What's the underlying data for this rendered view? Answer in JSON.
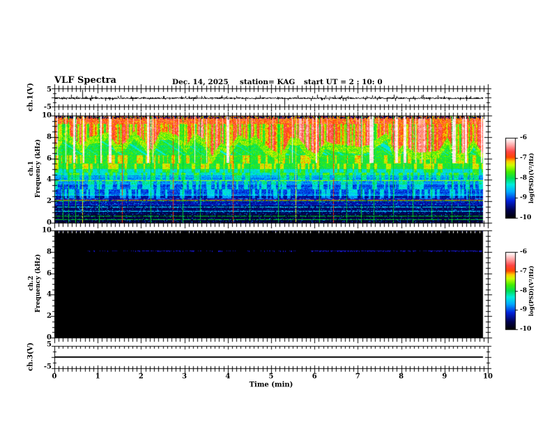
{
  "header": {
    "title": "VLF Spectra",
    "date": "Dec. 14, 2025",
    "station": "station= KAG",
    "start_ut": "start UT =  2 : 10: 0"
  },
  "axes": {
    "time_label": "Time (min)",
    "time_ticks": [
      0,
      1,
      2,
      3,
      4,
      5,
      6,
      7,
      8,
      9,
      10
    ],
    "time_minor_per_major": 10,
    "freq_ticks": [
      0,
      2,
      4,
      6,
      8,
      10
    ],
    "freq_minor_step_khz": 0.5,
    "volt_ticks": [
      5,
      -5
    ]
  },
  "panels": {
    "ch1_wave": {
      "ylabel": "ch.1(V)",
      "ymax_label": "5",
      "ymin_label": "-5"
    },
    "ch1_spec": {
      "label_line1": "ch.1",
      "label_line2": "Frequency (kHz)"
    },
    "ch2_spec": {
      "label_line1": "ch.2",
      "label_line2": "Frequency (kHz)"
    },
    "ch3_wave": {
      "ylabel": "ch.3(V)",
      "ymax_label": "5",
      "ymin_label": "-5"
    }
  },
  "colorbar": {
    "label": "log(PSD)(V²/Hz)",
    "ticks": [
      -6,
      -7,
      -8,
      -9,
      -10
    ],
    "gradient": [
      [
        0.0,
        "#000000"
      ],
      [
        0.1,
        "#00004d"
      ],
      [
        0.22,
        "#0022dd"
      ],
      [
        0.33,
        "#00aaff"
      ],
      [
        0.42,
        "#00eedd"
      ],
      [
        0.5,
        "#00dd55"
      ],
      [
        0.58,
        "#44ee00"
      ],
      [
        0.66,
        "#ccff00"
      ],
      [
        0.71,
        "#ffcc00"
      ],
      [
        0.76,
        "#ff4400"
      ],
      [
        0.83,
        "#ff4444"
      ],
      [
        0.9,
        "#ff9999"
      ],
      [
        0.96,
        "#ffdddd"
      ],
      [
        1.0,
        "#ffffff"
      ]
    ]
  },
  "chart_data": [
    {
      "id": "ch1_waveform",
      "type": "line",
      "channel": "ch.1(V)",
      "ylim": [
        -5,
        5
      ],
      "xlim_min": [
        0,
        10
      ],
      "baseline_v": 0,
      "noise_v": 0.45,
      "data_end_min": 9.85,
      "spikes": [
        {
          "t": 0.38,
          "v": 1.8
        },
        {
          "t": 0.52,
          "v": 1.2
        },
        {
          "t": 0.64,
          "v": 4.6
        },
        {
          "t": 0.72,
          "v": 1.0
        },
        {
          "t": 0.86,
          "v": 1.6
        },
        {
          "t": 0.95,
          "v": 1.2
        },
        {
          "t": 1.35,
          "v": -0.9
        },
        {
          "t": 1.77,
          "v": 1.1
        },
        {
          "t": 2.05,
          "v": 0.9
        },
        {
          "t": 2.5,
          "v": 1.0
        },
        {
          "t": 2.92,
          "v": 1.3
        },
        {
          "t": 3.45,
          "v": 1.0
        },
        {
          "t": 4.2,
          "v": 1.1
        },
        {
          "t": 4.75,
          "v": 1.5
        },
        {
          "t": 5.3,
          "v": -6.5
        },
        {
          "t": 5.95,
          "v": 1.0
        },
        {
          "t": 6.6,
          "v": 0.9
        },
        {
          "t": 7.4,
          "v": 1.0
        },
        {
          "t": 7.9,
          "v": 1.3
        },
        {
          "t": 8.5,
          "v": 1.0
        },
        {
          "t": 8.85,
          "v": 1.4
        },
        {
          "t": 9.35,
          "v": -1.2
        },
        {
          "t": 9.6,
          "v": 1.0
        }
      ]
    },
    {
      "id": "ch1_spectrogram",
      "type": "heatmap",
      "channel": "ch.1",
      "ylim_khz": [
        0,
        10
      ],
      "xlim_min": [
        0,
        10
      ],
      "data_end_min": 9.85,
      "psd_range": [
        -10,
        -6
      ],
      "bands": [
        {
          "f": [
            9.25,
            10.0
          ],
          "psd": -6.9,
          "jitter": 0.8
        },
        {
          "f": [
            6.3,
            9.25
          ],
          "psd": "curtain"
        },
        {
          "f": [
            5.0,
            6.3
          ],
          "psd": -7.85,
          "jitter": 0.5
        },
        {
          "f": [
            4.4,
            5.0
          ],
          "psd": -8.35,
          "jitter": 0.5
        },
        {
          "f": [
            3.6,
            4.4
          ],
          "psd": -8.7,
          "jitter": 0.5
        },
        {
          "f": [
            2.6,
            3.6
          ],
          "psd": -9.0,
          "jitter": 0.5
        },
        {
          "f": [
            1.6,
            2.6
          ],
          "psd": -9.3,
          "jitter": 0.4
        },
        {
          "f": [
            0.8,
            1.6
          ],
          "psd": -9.55,
          "jitter": 0.3
        },
        {
          "f": [
            0.0,
            0.8
          ],
          "psd": -9.7,
          "jitter": 0.25
        }
      ],
      "curtain": {
        "bottom_khz": [
          6.2,
          8.6
        ],
        "hi_psd": -6.9,
        "gap_psd": -7.8,
        "streak_psd": -6.1
      },
      "horizontal_lines": [
        {
          "f_khz": 3.95,
          "color": "yellow-green"
        },
        {
          "f_khz": 2.6,
          "color": "cyan"
        },
        {
          "f_khz": 2.15,
          "color": "red"
        },
        {
          "f_khz": 2.05,
          "color": "green"
        },
        {
          "f_khz": 1.5,
          "color": "cyan"
        },
        {
          "f_khz": 1.12,
          "color": "cyan"
        },
        {
          "f_khz": 0.62,
          "color": "green"
        },
        {
          "f_khz": 0.3,
          "color": "green"
        }
      ],
      "vertical_lines": [
        {
          "t_min": 0.18,
          "color": "green"
        },
        {
          "t_min": 0.3,
          "color": "green"
        },
        {
          "t_min": 0.46,
          "color": "green"
        },
        {
          "t_min": 0.62,
          "color": "yellow"
        },
        {
          "t_min": 1.02,
          "color": "green"
        },
        {
          "t_min": 1.55,
          "color": "red"
        },
        {
          "t_min": 2.2,
          "color": "green"
        },
        {
          "t_min": 2.72,
          "color": "red"
        },
        {
          "t_min": 2.95,
          "color": "green"
        },
        {
          "t_min": 3.35,
          "color": "green"
        },
        {
          "t_min": 4.1,
          "color": "red"
        },
        {
          "t_min": 4.48,
          "color": "green"
        },
        {
          "t_min": 5.15,
          "color": "green"
        },
        {
          "t_min": 5.55,
          "color": "yellow"
        },
        {
          "t_min": 6.1,
          "color": "green"
        },
        {
          "t_min": 6.42,
          "color": "red"
        },
        {
          "t_min": 6.72,
          "color": "green"
        },
        {
          "t_min": 7.05,
          "color": "green"
        },
        {
          "t_min": 7.35,
          "color": "green"
        },
        {
          "t_min": 7.8,
          "color": "green"
        },
        {
          "t_min": 8.25,
          "color": "green"
        },
        {
          "t_min": 8.68,
          "color": "green"
        },
        {
          "t_min": 9.15,
          "color": "green"
        },
        {
          "t_min": 9.55,
          "color": "green"
        }
      ]
    },
    {
      "id": "ch2_spectrogram",
      "type": "heatmap",
      "channel": "ch.2",
      "ylim_khz": [
        0,
        10
      ],
      "xlim_min": [
        0,
        10
      ],
      "data_end_min": 9.85,
      "background_psd": -10,
      "emission_line": {
        "f_khz": 8.1,
        "psd": -9.2,
        "segments": [
          {
            "t0": 0.7,
            "t1": 2.0,
            "density": 0.35
          },
          {
            "t0": 2.0,
            "t1": 3.4,
            "density": 0.55
          },
          {
            "t0": 3.4,
            "t1": 4.2,
            "density": 0.3
          },
          {
            "t0": 4.4,
            "t1": 5.6,
            "density": 0.25
          },
          {
            "t0": 5.9,
            "t1": 7.6,
            "density": 0.85
          },
          {
            "t0": 7.6,
            "t1": 8.8,
            "density": 0.5
          },
          {
            "t0": 8.8,
            "t1": 9.85,
            "density": 0.8
          }
        ]
      }
    },
    {
      "id": "ch3_waveform",
      "type": "line",
      "channel": "ch.3(V)",
      "ylim": [
        -5,
        5
      ],
      "xlim_min": [
        0,
        10
      ],
      "value_v": 0,
      "data_end_min": 9.85
    }
  ]
}
